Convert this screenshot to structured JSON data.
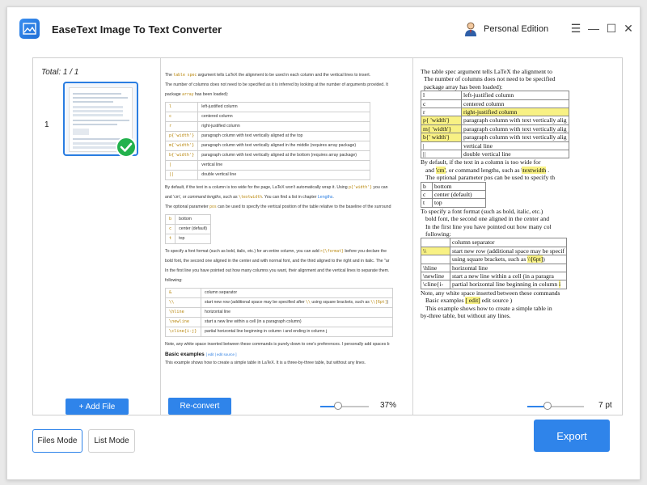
{
  "window": {
    "title": "EaseText Image To Text Converter",
    "edition": "Personal Edition",
    "controls": {
      "menu": "☰",
      "minimize": "—",
      "maximize": "☐",
      "close": "✕"
    }
  },
  "files": {
    "total": "Total: 1 / 1",
    "items": [
      {
        "index": "1",
        "status": "converted"
      }
    ],
    "add_label": "+ Add File"
  },
  "document": {
    "intro1": [
      "The ",
      "table spec",
      " argument tells LaTeX the alignment to be used in each column and the vertical lines to insert."
    ],
    "intro2": "The number of columns does not need to be specified as it is inferred by looking at the number of arguments provided. It",
    "intro3": [
      "package ",
      "array",
      " has been loaded):"
    ],
    "spec_rows": [
      {
        "code": "l",
        "desc": "left-justified column"
      },
      {
        "code": "c",
        "desc": "centered column"
      },
      {
        "code": "r",
        "desc": "right-justified column"
      },
      {
        "code": "p{'width'}",
        "desc": "paragraph column with text vertically aligned at the top"
      },
      {
        "code": "m{'width'}",
        "desc": "paragraph column with text vertically aligned in the middle (requires array package)"
      },
      {
        "code": "b{'width'}",
        "desc": "paragraph column with text vertically aligned at the bottom (requires array package)"
      },
      {
        "code": "|",
        "desc": "vertical line"
      },
      {
        "code": "||",
        "desc": "double vertical line"
      }
    ],
    "para_default": [
      "By default, if the text in a column is too wide for the page, LaTeX won't automatically wrap it. Using ",
      "p{'width'}",
      " you can"
    ],
    "para_default2": [
      "and 'cm', or ",
      "command lengths",
      ", such as ",
      "\\textwidth",
      ". You can find a list in chapter ",
      "Lengths",
      "."
    ],
    "para_pos": [
      "The optional parameter ",
      "pos",
      " can be used to specify the vertical position of the table relative to the baseline of the surround"
    ],
    "pos_rows": [
      {
        "code": "b",
        "desc": "bottom"
      },
      {
        "code": "c",
        "desc": "center (default)"
      },
      {
        "code": "t",
        "desc": "top"
      }
    ],
    "para_font": [
      "To specify a font format (such as bold, italic, etc.) for an entire column, you can add ",
      ">{\\format}",
      " before you declare the"
    ],
    "para_font2": "bold font, the second one aligned in the center and with normal font, and the third aligned to the right and in italic. The \"ar",
    "para_first": "In the first line you have pointed out how many columns you want, their alignment and the vertical lines to separate them.",
    "para_first2": "following:",
    "cmd_rows": [
      {
        "code": "&",
        "desc": "column separator"
      },
      {
        "code": "\\\\",
        "desc_parts": [
          "start new row (additional space may be specified after ",
          "\\\\",
          " using square brackets, such as ",
          "\\\\[6pt]",
          ")"
        ]
      },
      {
        "code": "\\hline",
        "desc": "horizontal line"
      },
      {
        "code": "\\newline",
        "desc": "start a new line within a cell (in a paragraph column)"
      },
      {
        "code": "\\cline{i-j}",
        "desc": "partial horizontal line beginning in column i and ending in column j"
      }
    ],
    "para_note": "Note, any white space inserted between these commands is purely down to one's preferences. I personally add spaces b",
    "basic_heading": "Basic examples",
    "basic_links": "[ edit | edit source ]",
    "basic_text": "This example shows how to create a simple table in LaTeX. It is a three-by-three table, but without any lines.",
    "reconvert_label": "Re-convert",
    "zoom": {
      "value": "37%",
      "level": 0.37
    }
  },
  "ocr": {
    "l1": "The table spec argument tells LaTeX the alignment to",
    "l2": "The number of columns does not need to be specified",
    "l3": "package array has been loaded):",
    "spec_rows": [
      {
        "code": "l",
        "desc": "left-justified column"
      },
      {
        "code": "c",
        "desc": "centered column"
      },
      {
        "code": "r",
        "desc": "right-justified column"
      },
      {
        "code": "p{ 'width'}",
        "desc": "paragraph column with text vertically alig"
      },
      {
        "code": "m{ 'width'}",
        "desc": "paragraph column with text vertically alig"
      },
      {
        "code": "b{' width'}",
        "desc": "paragraph column with text vertically alig"
      },
      {
        "code": "|",
        "desc": "vertical line"
      },
      {
        "code": "||",
        "desc": "double vertical line"
      }
    ],
    "d1": "By default, if the text in a column is too wide for",
    "d2_parts": [
      "and ",
      "'cm'",
      ", or command lengths, such as ",
      "\\textwidth",
      " ."
    ],
    "d3": "The optional parameter pos can be used to specify th",
    "pos_rows": [
      {
        "code": "b",
        "desc": "bottom"
      },
      {
        "code": "c",
        "desc": "center (default)"
      },
      {
        "code": "t",
        "desc": "top"
      }
    ],
    "f1": "To specify a font format (such as bold, italic, etc.)",
    "f2": "bold font, the second one aligned in the center and",
    "f3": "In the first line you have pointed out how many col",
    "f4": "following:",
    "cmd_rows": [
      {
        "code": "",
        "desc": "column separator"
      },
      {
        "code": "\\\\",
        "desc": "start new row (additional space may be specif"
      },
      {
        "code": "",
        "desc_parts": [
          "using square brackets, such as ",
          "\\\\[6pt]",
          ")"
        ]
      },
      {
        "code": "\\hline",
        "desc": "horizontal line"
      },
      {
        "code": "\\newline",
        "desc": "start a new line within a cell (in a paragra"
      },
      {
        "code": "\\cline{i-",
        "desc_parts": [
          "partial horizontal line beginning in column ",
          "i"
        ]
      }
    ],
    "n1": "Note, any white space inserted between these commands",
    "n2_parts": [
      "Basic examples ",
      "[ edit]",
      " edit source )"
    ],
    "n3": "This example shows how to create a simple table in",
    "n4": "by-three table, but without any lines.",
    "font_size": {
      "value": "7 pt",
      "level": 0.35
    }
  },
  "modes": {
    "files": "Files Mode",
    "list": "List Mode"
  },
  "export_label": "Export",
  "colors": {
    "accent": "#2f84ea",
    "success": "#22b14c",
    "highlight": "#f8f184"
  }
}
